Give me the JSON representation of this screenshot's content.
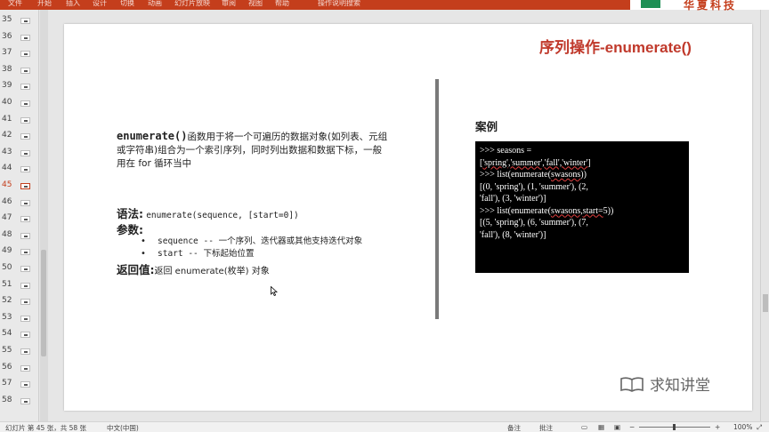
{
  "ribbon": {
    "tabs": [
      "文件",
      "开始",
      "插入",
      "设计",
      "切换",
      "动画",
      "幻灯片放映",
      "审阅",
      "视图",
      "帮助",
      "操作说明搜索"
    ],
    "brand": "华夏科技",
    "accent": "#c43e1c"
  },
  "thumbnails": [
    {
      "num": "35"
    },
    {
      "num": "36"
    },
    {
      "num": "37"
    },
    {
      "num": "38"
    },
    {
      "num": "39"
    },
    {
      "num": "40"
    },
    {
      "num": "41"
    },
    {
      "num": "42"
    },
    {
      "num": "43"
    },
    {
      "num": "44"
    },
    {
      "num": "45",
      "active": true
    },
    {
      "num": "46"
    },
    {
      "num": "47"
    },
    {
      "num": "48"
    },
    {
      "num": "49"
    },
    {
      "num": "50"
    },
    {
      "num": "51"
    },
    {
      "num": "52"
    },
    {
      "num": "53"
    },
    {
      "num": "54"
    },
    {
      "num": "55"
    },
    {
      "num": "56"
    },
    {
      "num": "57"
    },
    {
      "num": "58"
    }
  ],
  "slide": {
    "title": "序列操作-enumerate()",
    "title_color": "#c0392b",
    "intro_keyword": "enumerate()",
    "intro_text": "函数用于将一个可遍历的数据对象(如列表、元组或字符串)组合为一个索引序列，同时列出数据和数据下标，一般用在 for 循环当中",
    "syntax_label": "语法:",
    "syntax_value": "enumerate(sequence, [start=0])",
    "params_label": "参数:",
    "params": [
      "sequence -- 一个序列、迭代器或其他支持迭代对象",
      "start -- 下标起始位置"
    ],
    "return_label": "返回值:",
    "return_text": "返回 enumerate(枚举) 对象",
    "example_label": "案例",
    "code": {
      "l1": ">>> seasons =",
      "l2a": "[",
      "l2b": "'spring','summer','fall','winter'",
      "l2c": "]",
      "l3a": ">>> list(enumerate(",
      "l3b": "swasons",
      "l3c": "))",
      "l4": "[(0, 'spring'), (1, 'summer'), (2,",
      "l5": "'fall'), (3, 'winter')]",
      "l6a": ">>> list(enumerate(",
      "l6b": "swasons,start=",
      "l6c": "5))",
      "l7": "[(5, 'spring'), (6, 'summer'), (7,",
      "l8": "'fall'), (8, 'winter')]"
    },
    "watermark": "求知讲堂"
  },
  "status": {
    "slide_info": "幻灯片 第 45 张，共 58 张",
    "language": "中文(中国)",
    "notes": "备注",
    "comments": "批注",
    "zoom": "100%"
  }
}
